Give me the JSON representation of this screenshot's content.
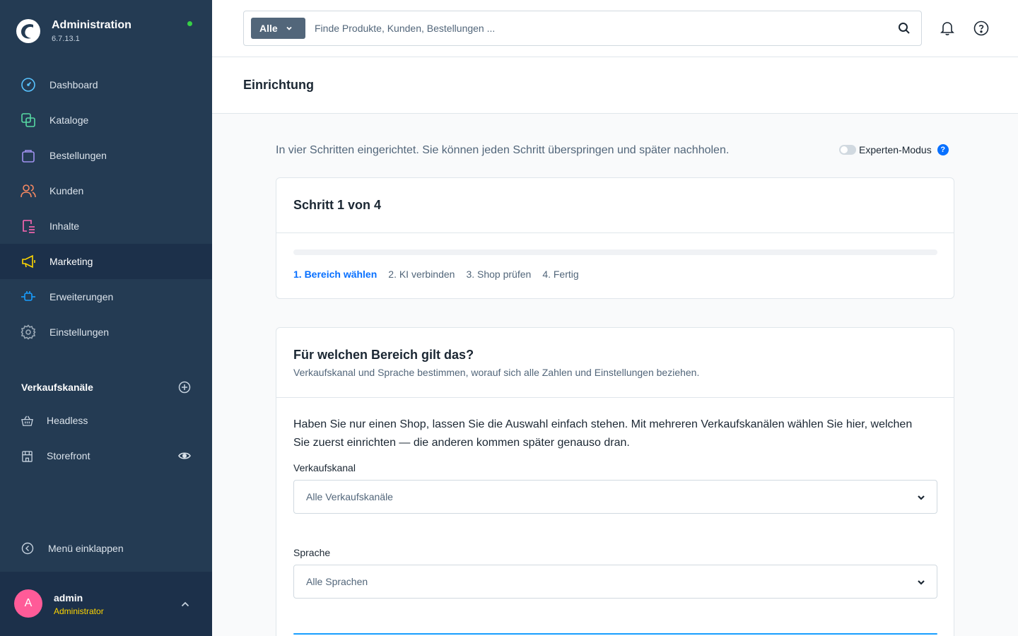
{
  "app": {
    "title": "Administration",
    "version": "6.7.13.1",
    "status_color": "#37d046"
  },
  "nav": {
    "items": [
      {
        "label": "Dashboard",
        "icon": "dashboard-icon",
        "color": "#58c3ff"
      },
      {
        "label": "Kataloge",
        "icon": "catalog-icon",
        "color": "#57d9a3"
      },
      {
        "label": "Bestellungen",
        "icon": "shopping-bag-icon",
        "color": "#a092f0"
      },
      {
        "label": "Kunden",
        "icon": "users-icon",
        "color": "#f88962"
      },
      {
        "label": "Inhalte",
        "icon": "content-icon",
        "color": "#ff68b4"
      },
      {
        "label": "Marketing",
        "icon": "megaphone-icon",
        "color": "#ffd700",
        "active": true
      },
      {
        "label": "Erweiterungen",
        "icon": "plug-icon",
        "color": "#189eff"
      },
      {
        "label": "Einstellungen",
        "icon": "gear-icon",
        "color": "#9aa8b5"
      }
    ]
  },
  "sales_channels": {
    "title": "Verkaufskanäle",
    "items": [
      {
        "label": "Headless",
        "icon": "basket-icon"
      },
      {
        "label": "Storefront",
        "icon": "storefront-icon"
      }
    ]
  },
  "collapse_label": "Menü einklappen",
  "user": {
    "initial": "A",
    "name": "admin",
    "role": "Administrator"
  },
  "search": {
    "type_label": "Alle",
    "placeholder": "Finde Produkte, Kunden, Bestellungen ..."
  },
  "page": {
    "title": "Einrichtung",
    "intro": "In vier Schritten eingerichtet. Sie können jeden Schritt überspringen und später nachholen.",
    "expert_label": "Experten-Modus",
    "info_glyph": "?"
  },
  "wizard": {
    "title": "Schritt 1 von 4",
    "progress": 0,
    "steps": [
      "1. Bereich wählen",
      "2. KI verbinden",
      "3. Shop prüfen",
      "4. Fertig"
    ]
  },
  "scope": {
    "title": "Für welchen Bereich gilt das?",
    "subtitle": "Verkaufskanal und Sprache bestimmen, worauf sich alle Zahlen und Einstellungen beziehen.",
    "text": "Haben Sie nur einen Shop, lassen Sie die Auswahl einfach stehen. Mit mehreren Verkaufskanälen wählen Sie hier, welchen Sie zuerst einrichten — die anderen kommen später genauso dran.",
    "channel_label": "Verkaufskanal",
    "channel_value": "Alle Verkaufskanäle",
    "language_label": "Sprache",
    "language_value": "Alle Sprachen"
  }
}
